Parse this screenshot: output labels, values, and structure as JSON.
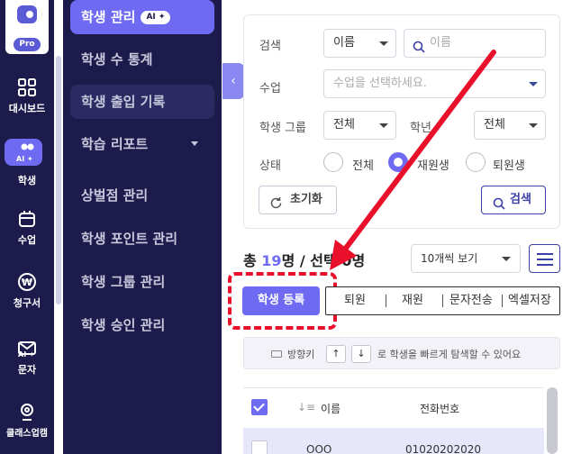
{
  "rail": {
    "pro_badge": "Pro",
    "ai_tag": "AI ✦",
    "items": [
      {
        "label": "대시보드",
        "icon": "dashboard-grid-icon"
      },
      {
        "label": "학생",
        "icon": "users-icon"
      },
      {
        "label": "수업",
        "icon": "calendar-icon"
      },
      {
        "label": "청구서",
        "icon": "won-currency-icon"
      },
      {
        "label": "문자",
        "icon": "mail-icon"
      },
      {
        "label": "클래스업캠",
        "icon": "webcam-icon"
      }
    ]
  },
  "submenu": {
    "ai_pill": "AI ✦",
    "items": [
      {
        "label": "학생 관리"
      },
      {
        "label": "학생 수 통계"
      },
      {
        "label": "학생 출입 기록"
      },
      {
        "label": "학습 리포트"
      },
      {
        "label": "상벌점 관리"
      },
      {
        "label": "학생 포인트 관리"
      },
      {
        "label": "학생 그룹 관리"
      },
      {
        "label": "학생 승인 관리"
      }
    ],
    "collapse_glyph": "‹"
  },
  "filter": {
    "search_label": "검색",
    "search_field_value": "이름",
    "search_placeholder": "이름",
    "class_label": "수업",
    "class_placeholder": "수업을 선택하세요.",
    "group_label": "학생 그룹",
    "group_value": "전체",
    "grade_label": "학년",
    "grade_value": "전체",
    "status_label": "상태",
    "status_options": [
      {
        "label": "전체",
        "checked": false
      },
      {
        "label": "재원생",
        "checked": true
      },
      {
        "label": "퇴원생",
        "checked": false
      }
    ],
    "reset_label": "초기화",
    "search_button_label": "검색"
  },
  "summary": {
    "total_prefix": "총 ",
    "total_count": "19",
    "total_suffix": "명 / 선택",
    "selected_count": "0",
    "selected_suffix": "명",
    "page_size": "10개씩 보기"
  },
  "actions": {
    "register": "학생 등록",
    "withdraw": "퇴원",
    "reenroll": "재원",
    "send_sms": "문자전송",
    "excel_save": "엑셀저장"
  },
  "hint": {
    "prefix": "방향키",
    "up": "↑",
    "down": "↓",
    "suffix": "로 학생을 빠르게 탐색할 수 있어요"
  },
  "table": {
    "sort_glyph": "↓≡",
    "col_name": "이름",
    "col_phone": "전화번호",
    "rows": [
      {
        "name": "OOO",
        "phone": "01020202020"
      }
    ]
  },
  "colors": {
    "accent": "#6e6bf2",
    "sidebar_bg": "#1d1b4b",
    "annotation_red": "#e8102b"
  }
}
